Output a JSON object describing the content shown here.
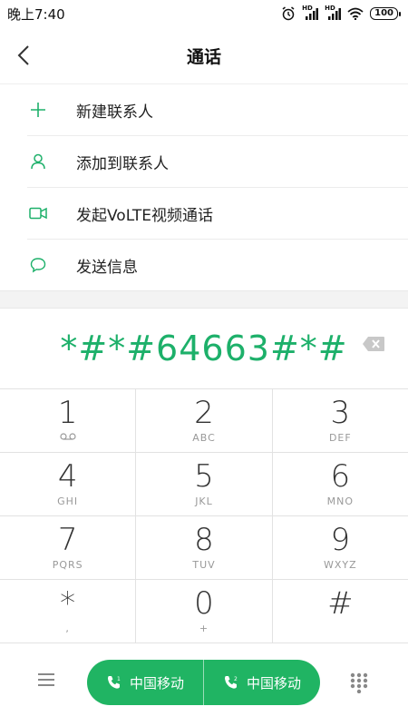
{
  "status": {
    "time": "晚上7:40",
    "battery": "100",
    "hd1": "HD",
    "hd2": "HD"
  },
  "header": {
    "title": "通话"
  },
  "actions": [
    {
      "label": "新建联系人",
      "icon": "plus-icon"
    },
    {
      "label": "添加到联系人",
      "icon": "person-icon"
    },
    {
      "label": "发起VoLTE视频通话",
      "icon": "video-icon"
    },
    {
      "label": "发送信息",
      "icon": "message-icon"
    }
  ],
  "dialer": {
    "number": "*#*#64663#*#"
  },
  "keypad": [
    [
      {
        "digit": "1",
        "sub": ""
      },
      {
        "digit": "2",
        "sub": "ABC"
      },
      {
        "digit": "3",
        "sub": "DEF"
      }
    ],
    [
      {
        "digit": "4",
        "sub": "GHI"
      },
      {
        "digit": "5",
        "sub": "JKL"
      },
      {
        "digit": "6",
        "sub": "MNO"
      }
    ],
    [
      {
        "digit": "7",
        "sub": "PQRS"
      },
      {
        "digit": "8",
        "sub": "TUV"
      },
      {
        "digit": "9",
        "sub": "WXYZ"
      }
    ],
    [
      {
        "digit": "*",
        "sub": ","
      },
      {
        "digit": "0",
        "sub": "+"
      },
      {
        "digit": "#",
        "sub": ""
      }
    ]
  ],
  "calls": {
    "sim1_label": "中国移动",
    "sim2_label": "中国移动",
    "sim1_index": "1",
    "sim2_index": "2"
  },
  "colors": {
    "accent": "#1db06a",
    "call_button": "#20b463"
  }
}
